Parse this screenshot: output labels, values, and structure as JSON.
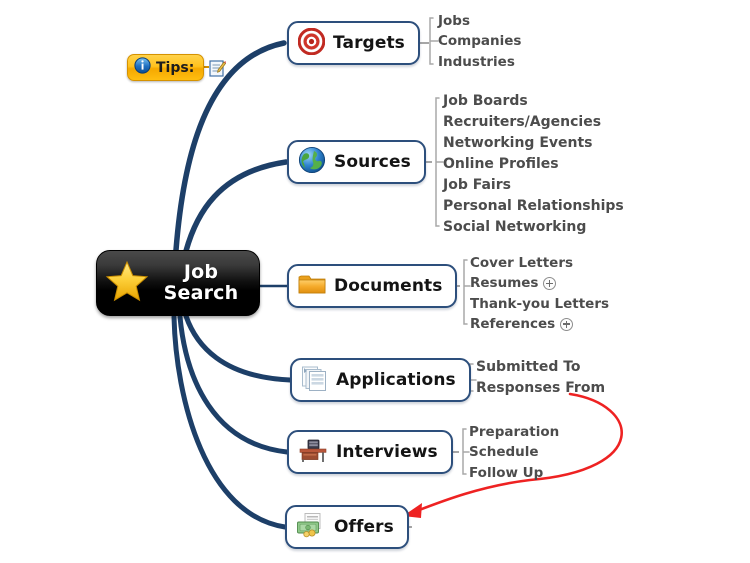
{
  "map": {
    "central": {
      "line1": "Job",
      "line2": "Search",
      "icon": "star-icon"
    },
    "tips": {
      "label": "Tips:",
      "info_icon": "info-icon",
      "note_icon": "note-icon"
    },
    "branches": [
      {
        "id": "targets",
        "label": "Targets",
        "icon": "target-icon",
        "children": [
          {
            "label": "Jobs"
          },
          {
            "label": "Companies"
          },
          {
            "label": "Industries"
          }
        ]
      },
      {
        "id": "sources",
        "label": "Sources",
        "icon": "globe-icon",
        "children": [
          {
            "label": "Job Boards"
          },
          {
            "label": "Recruiters/Agencies"
          },
          {
            "label": "Networking Events"
          },
          {
            "label": "Online Profiles"
          },
          {
            "label": "Job Fairs"
          },
          {
            "label": "Personal Relationships"
          },
          {
            "label": "Social Networking"
          }
        ]
      },
      {
        "id": "documents",
        "label": "Documents",
        "icon": "folder-icon",
        "children": [
          {
            "label": "Cover Letters"
          },
          {
            "label": "Resumes",
            "expandable": true
          },
          {
            "label": "Thank-you Letters"
          },
          {
            "label": "References",
            "expandable": true
          }
        ]
      },
      {
        "id": "applications",
        "label": "Applications",
        "icon": "documents-icon",
        "children": [
          {
            "label": "Submitted To"
          },
          {
            "label": "Responses From"
          }
        ]
      },
      {
        "id": "interviews",
        "label": "Interviews",
        "icon": "desk-icon",
        "children": [
          {
            "label": "Preparation"
          },
          {
            "label": "Schedule"
          },
          {
            "label": "Follow Up"
          }
        ]
      },
      {
        "id": "offers",
        "label": "Offers",
        "icon": "money-icon",
        "children": []
      }
    ],
    "relationship_arrow": {
      "name": "responses-to-offers-arrow",
      "from": "Responses From",
      "to": "Offers"
    },
    "colors": {
      "branch_line": "#1d3f68",
      "branch_border": "#2d4f7c",
      "sub_line": "#a8a8a8",
      "sub_text": "#4c4c4c",
      "central_bg": "#000000",
      "central_text": "#ffffff",
      "tips_bg": "#ffc21e",
      "relationship_arrow": "#ee2222",
      "canvas_bg": "#ffffff"
    }
  }
}
